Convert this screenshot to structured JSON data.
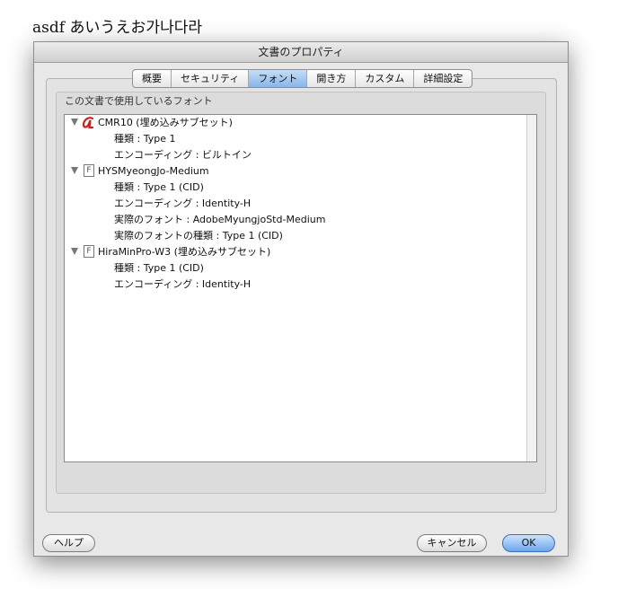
{
  "page": {
    "title": "asdf あいうえお가나다라"
  },
  "dialog": {
    "title": "文書のプロパティ",
    "tabs": [
      {
        "label": "概要"
      },
      {
        "label": "セキュリティ"
      },
      {
        "label": "フォント",
        "selected": true
      },
      {
        "label": "開き方"
      },
      {
        "label": "カスタム"
      },
      {
        "label": "詳細設定"
      }
    ],
    "group_label": "この文書で使用しているフォント",
    "fonts": [
      {
        "name": "CMR10 (埋め込みサブセット)",
        "icon": "type1-font-icon",
        "props": [
          "種類 : Type 1",
          "エンコーディング : ビルトイン"
        ]
      },
      {
        "name": "HYSMyeongJo-Medium",
        "icon": "document-font-icon",
        "props": [
          "種類 : Type 1 (CID)",
          "エンコーディング : Identity-H",
          "実際のフォント : AdobeMyungjoStd-Medium",
          "実際のフォントの種類 : Type 1 (CID)"
        ]
      },
      {
        "name": "HiraMinPro-W3 (埋め込みサブセット)",
        "icon": "document-font-icon",
        "props": [
          "種類 : Type 1 (CID)",
          "エンコーディング : Identity-H"
        ]
      }
    ],
    "buttons": {
      "help": "ヘルプ",
      "cancel": "キャンセル",
      "ok": "OK"
    }
  }
}
